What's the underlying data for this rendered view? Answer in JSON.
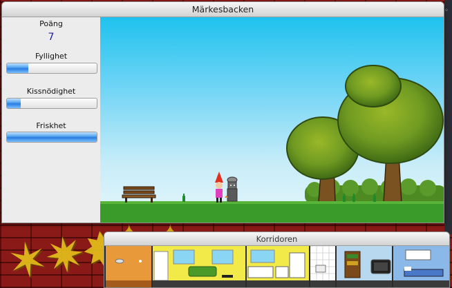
{
  "window": {
    "title": "Märkesbacken"
  },
  "stats": [
    {
      "label": "Poäng",
      "value": "7"
    },
    {
      "label": "Fyllighet",
      "level": 0.24
    },
    {
      "label": "Kissnödighet",
      "level": 0.15
    },
    {
      "label": "Friskhet",
      "level": 1.0
    }
  ],
  "corridor": {
    "title": "Korridoren",
    "rooms": [
      "hallway",
      "living-room",
      "kitchen",
      "bathroom",
      "tv-room",
      "bedroom"
    ]
  },
  "colors": {
    "sky_top": "#1fc2ef",
    "grass": "#3a9a2a",
    "bar_fill": "#2a7de0",
    "score": "#1a1aa8",
    "wall": "#8a1a17"
  },
  "icons": [
    "bench-icon",
    "bottle-icon",
    "tree-icon",
    "character-wizard-icon",
    "character-dog-icon"
  ]
}
